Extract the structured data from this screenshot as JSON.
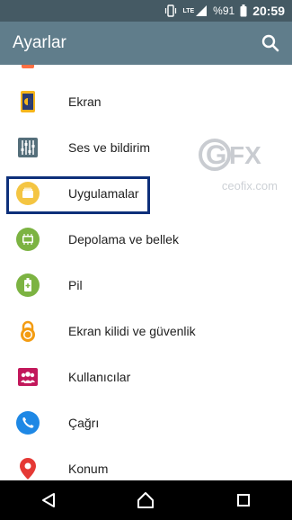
{
  "status": {
    "network": "LTE",
    "battery": "%91",
    "clock": "20:59"
  },
  "appbar": {
    "title": "Ayarlar",
    "search_icon": "search-icon"
  },
  "watermark": {
    "logo": "GFX",
    "text": "ceofix.com"
  },
  "settings": [
    {
      "label": "Ekran",
      "icon": "display-icon",
      "color": "#f6b51b"
    },
    {
      "label": "Ses ve bildirim",
      "icon": "equalizer-icon",
      "color": "#546e7a"
    },
    {
      "label": "Uygulamalar",
      "icon": "apps-icon",
      "color": "#f4c542"
    },
    {
      "label": "Depolama ve bellek",
      "icon": "storage-icon",
      "color": "#7cb342"
    },
    {
      "label": "Pil",
      "icon": "battery-icon",
      "color": "#7cb342"
    },
    {
      "label": "Ekran kilidi ve güvenlik",
      "icon": "lock-icon",
      "color": "#f39c12"
    },
    {
      "label": "Kullanıcılar",
      "icon": "users-icon",
      "color": "#c2185b"
    },
    {
      "label": "Çağrı",
      "icon": "phone-icon",
      "color": "#1e88e5"
    },
    {
      "label": "Konum",
      "icon": "location-icon",
      "color": "#e53935"
    }
  ],
  "nav": {
    "back": "back-icon",
    "home": "home-icon",
    "recents": "recents-icon"
  }
}
